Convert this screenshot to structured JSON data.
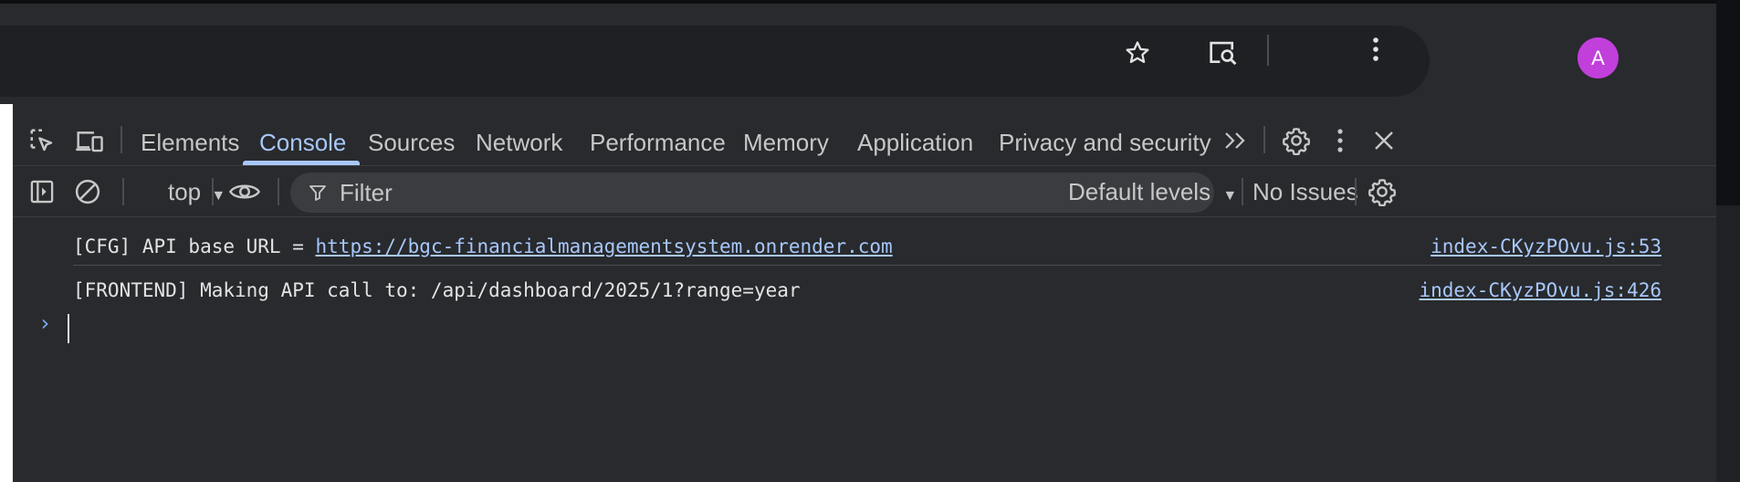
{
  "chrome": {
    "star_icon": "star-icon",
    "lens_icon": "search-tab-icon",
    "avatar_letter": "A",
    "menu_icon": "kebab-icon"
  },
  "devtools": {
    "tabs": [
      {
        "label": "Elements",
        "active": false
      },
      {
        "label": "Console",
        "active": true
      },
      {
        "label": "Sources",
        "active": false
      },
      {
        "label": "Network",
        "active": false
      },
      {
        "label": "Performance",
        "active": false
      },
      {
        "label": "Memory",
        "active": false
      },
      {
        "label": "Application",
        "active": false
      },
      {
        "label": "Privacy and security",
        "active": false
      }
    ],
    "more_tabs": "»"
  },
  "toolbar": {
    "context": "top",
    "filter_placeholder": "Filter",
    "levels": "Default levels",
    "issues": "No Issues"
  },
  "console": {
    "messages": [
      {
        "prefix": "[CFG] API base URL = ",
        "link": "https://bgc-financialmanagementsystem.onrender.com",
        "source": "index-CKyzPOvu.js:53"
      },
      {
        "prefix": "[FRONTEND] Making API call to: /api/dashboard/2025/1?range=year",
        "link": "",
        "source": "index-CKyzPOvu.js:426"
      }
    ],
    "prompt": "›"
  },
  "colors": {
    "accent": "#a8c7fa",
    "avatar": "#c13fdb",
    "background": "#282a2d"
  }
}
